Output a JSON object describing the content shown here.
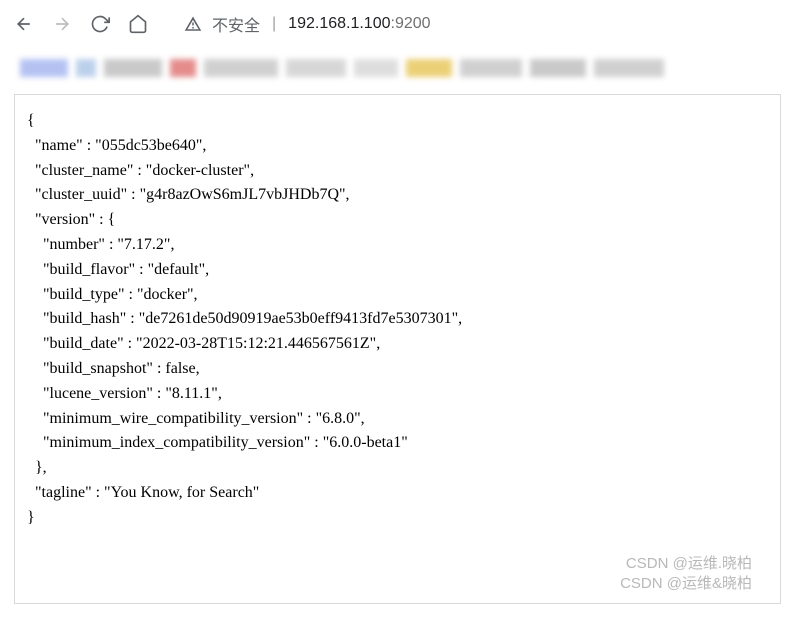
{
  "toolbar": {
    "not_secure_label": "不安全",
    "url_host": "192.168.1.100",
    "url_port": ":9200"
  },
  "response": {
    "name": "055dc53be640",
    "cluster_name": "docker-cluster",
    "cluster_uuid": "g4r8azOwS6mJL7vbJHDb7Q",
    "version": {
      "number": "7.17.2",
      "build_flavor": "default",
      "build_type": "docker",
      "build_hash": "de7261de50d90919ae53b0eff9413fd7e5307301",
      "build_date": "2022-03-28T15:12:21.446567561Z",
      "build_snapshot": "false",
      "lucene_version": "8.11.1",
      "minimum_wire_compatibility_version": "6.8.0",
      "minimum_index_compatibility_version": "6.0.0-beta1"
    },
    "tagline": "You Know, for Search"
  },
  "watermark": {
    "line1": "CSDN @运维.晓柏",
    "line2": "CSDN @运维&晓柏"
  },
  "bookmarks": [
    {
      "w": 48,
      "c": "#a8b8f0"
    },
    {
      "w": 20,
      "c": "#b0c8e8"
    },
    {
      "w": 58,
      "c": "#c0c0c0"
    },
    {
      "w": 26,
      "c": "#e07878"
    },
    {
      "w": 74,
      "c": "#c8c8c8"
    },
    {
      "w": 60,
      "c": "#d0d0d0"
    },
    {
      "w": 44,
      "c": "#d8d8d8"
    },
    {
      "w": 46,
      "c": "#e8c860"
    },
    {
      "w": 62,
      "c": "#c8c8c8"
    },
    {
      "w": 56,
      "c": "#c0c0c0"
    },
    {
      "w": 70,
      "c": "#c8c8c8"
    }
  ]
}
